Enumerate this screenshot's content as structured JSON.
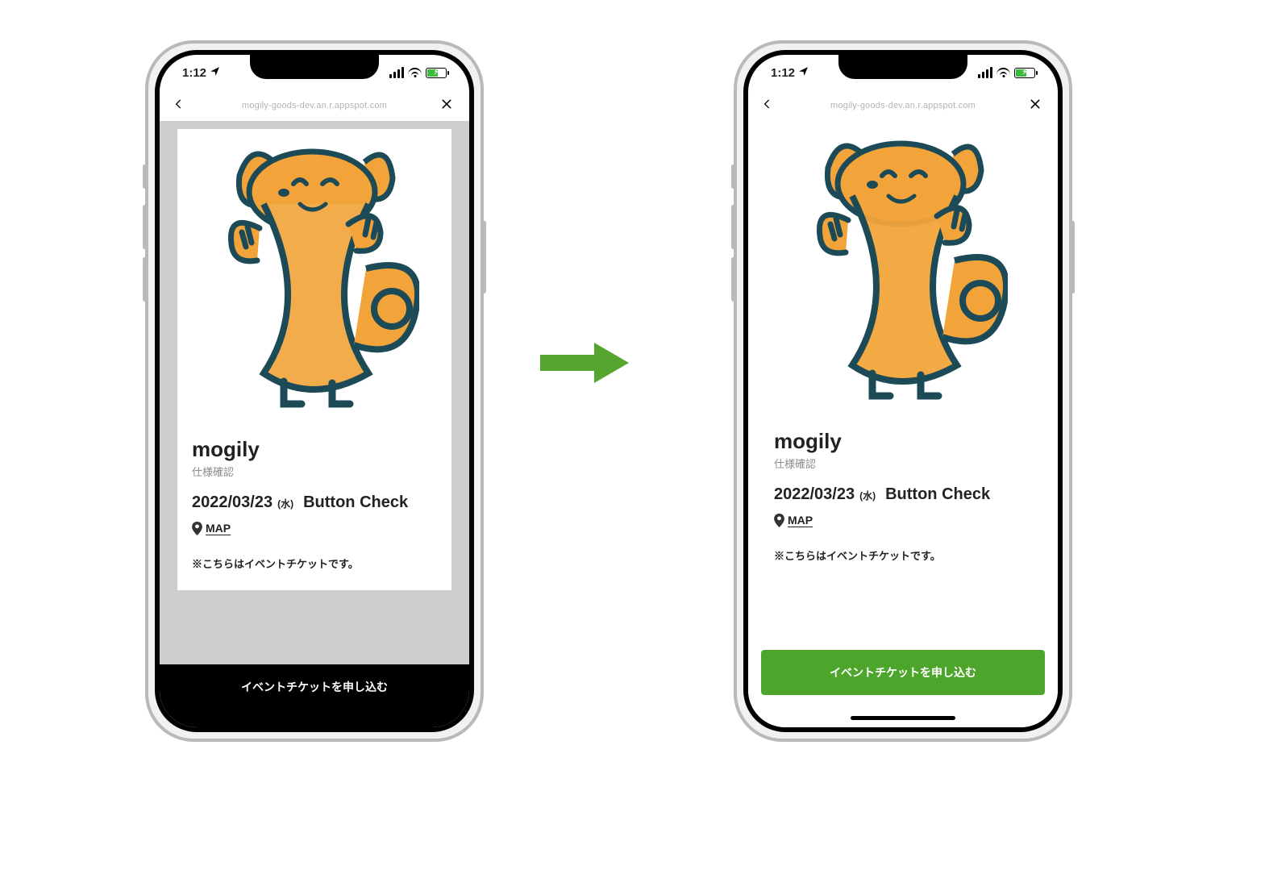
{
  "status": {
    "time": "1:12",
    "location_icon": "location-arrow-icon"
  },
  "nav": {
    "url": "mogily-goods-dev.an.r.appspot.com"
  },
  "card": {
    "brand": "mogily",
    "spec_label": "仕様確認",
    "date": "2022/03/23",
    "dow": "(水)",
    "event_title": "Button Check",
    "map_label": "MAP",
    "note": "※こちらはイベントチケットです。"
  },
  "cta": {
    "label_black": "イベントチケットを申し込む",
    "label_green": "イベントチケットを申し込む"
  },
  "colors": {
    "button_green": "#4ea52c",
    "arrow_green": "#55a52e"
  }
}
